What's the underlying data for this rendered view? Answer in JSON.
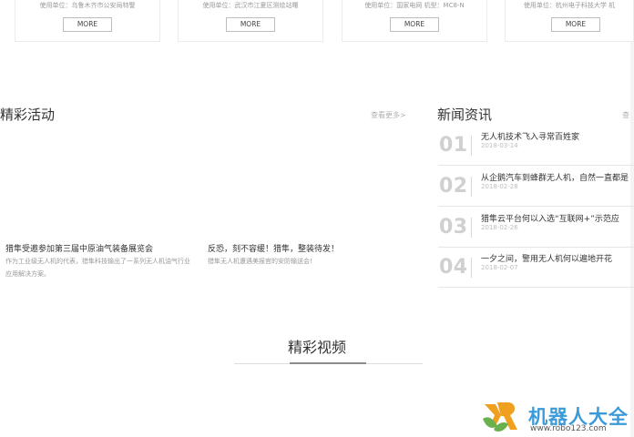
{
  "cards": [
    {
      "user": "使用单位：乌鲁木齐市公安局特警",
      "more_label": "MORE"
    },
    {
      "user": "使用单位：武汉市江夏区测绘站曙",
      "more_label": "MORE"
    },
    {
      "user": "使用单位：国家电网 机型：MC8-N",
      "more_label": "MORE"
    },
    {
      "user": "使用单位：杭州电子科技大学 机",
      "more_label": "MORE"
    }
  ],
  "activities": {
    "title": "精彩活动",
    "more_label": "查看更多>",
    "items": [
      {
        "title": "猎隼受邀参加第三届中原油气装备展览会",
        "desc_lines": [
          "作为工业级无人机的代表，猎隼科技输出了一系列无人机油气行业",
          "应用解决方案。"
        ]
      },
      {
        "title": "反恐，刻不容缓！猎隼，整装待发！",
        "desc_lines": [
          "猎隼无人机遭遇美报官的安防输送会!"
        ]
      }
    ]
  },
  "news": {
    "title": "新闻资讯",
    "more_label": "查",
    "items": [
      {
        "num": "01",
        "title": "无人机技术飞入寻常百姓家",
        "date": "2018-03-14"
      },
      {
        "num": "02",
        "title": "从企鹅汽车到蜂群无人机，自然一直都是",
        "date": "2018-02-28"
      },
      {
        "num": "03",
        "title": "猎隼云平台何以入选“互联网+”示范应",
        "date": "2018-02-26"
      },
      {
        "num": "04",
        "title": "一夕之间，警用无人机何以遍地开花",
        "date": "2018-02-07"
      }
    ]
  },
  "video": {
    "title": "精彩视频"
  },
  "watermark": {
    "name": "机器人大全",
    "url": "www.robo123.com",
    "accent": "#3a9bd8"
  }
}
